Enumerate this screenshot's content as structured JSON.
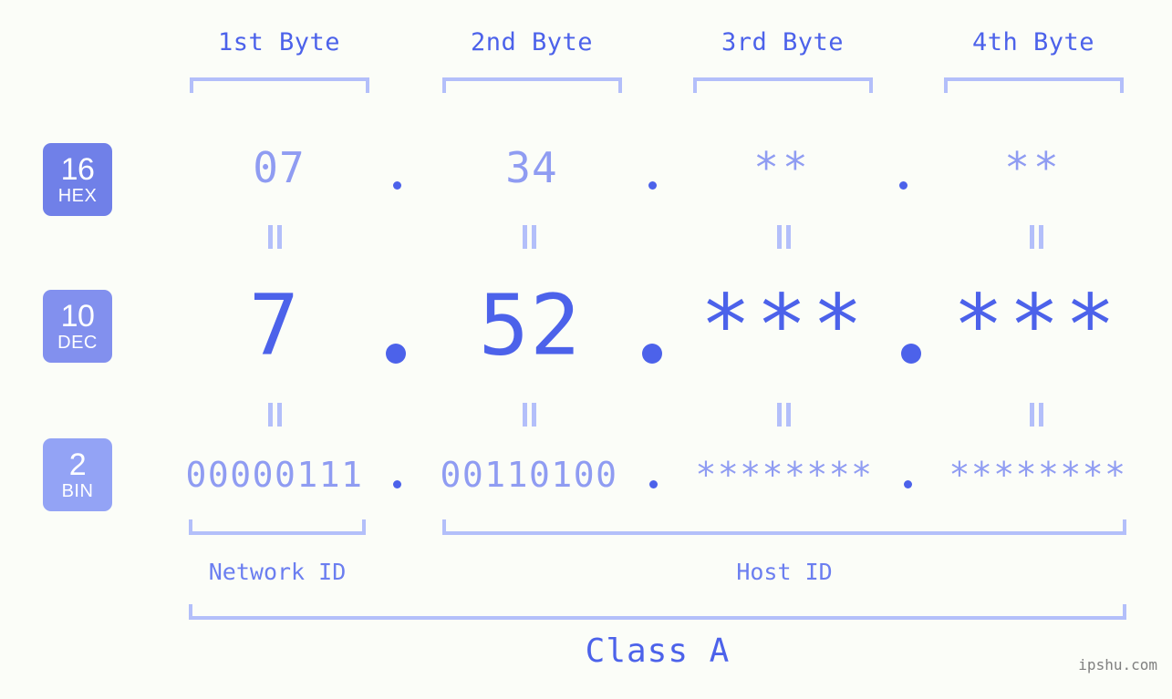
{
  "meta": {
    "background_color": "#fbfdf8",
    "accent_strong": "#4c62ea",
    "accent_mid": "#8f9cf2",
    "accent_light": "#b3bffa",
    "watermark": "ipshu.com"
  },
  "byte_headers": [
    {
      "label": "1st Byte"
    },
    {
      "label": "2nd Byte"
    },
    {
      "label": "3rd Byte"
    },
    {
      "label": "4th Byte"
    }
  ],
  "bases": [
    {
      "number": "16",
      "name": "HEX",
      "color": "#7080e8"
    },
    {
      "number": "10",
      "name": "DEC",
      "color": "#8290ee"
    },
    {
      "number": "2",
      "name": "BIN",
      "color": "#93a3f5"
    }
  ],
  "rows": {
    "hex": {
      "base_number": "16",
      "base_name": "HEX",
      "values": [
        "07",
        "34",
        "**",
        "**"
      ],
      "separators": [
        ".",
        ".",
        "."
      ]
    },
    "dec": {
      "base_number": "10",
      "base_name": "DEC",
      "values": [
        "7",
        "52",
        "***",
        "***"
      ],
      "separators": [
        ".",
        ".",
        "."
      ]
    },
    "bin": {
      "base_number": "2",
      "base_name": "BIN",
      "values": [
        "00000111",
        "00110100",
        "********",
        "********"
      ],
      "separators": [
        ".",
        ".",
        "."
      ]
    }
  },
  "equality_marks": {
    "symbol": "=",
    "count_per_row": 4,
    "rows": 2
  },
  "sections": [
    {
      "label": "Network ID",
      "span": "1st Byte"
    },
    {
      "label": "Host ID",
      "span": "2nd-4th Bytes"
    }
  ],
  "class_label": "Class A"
}
